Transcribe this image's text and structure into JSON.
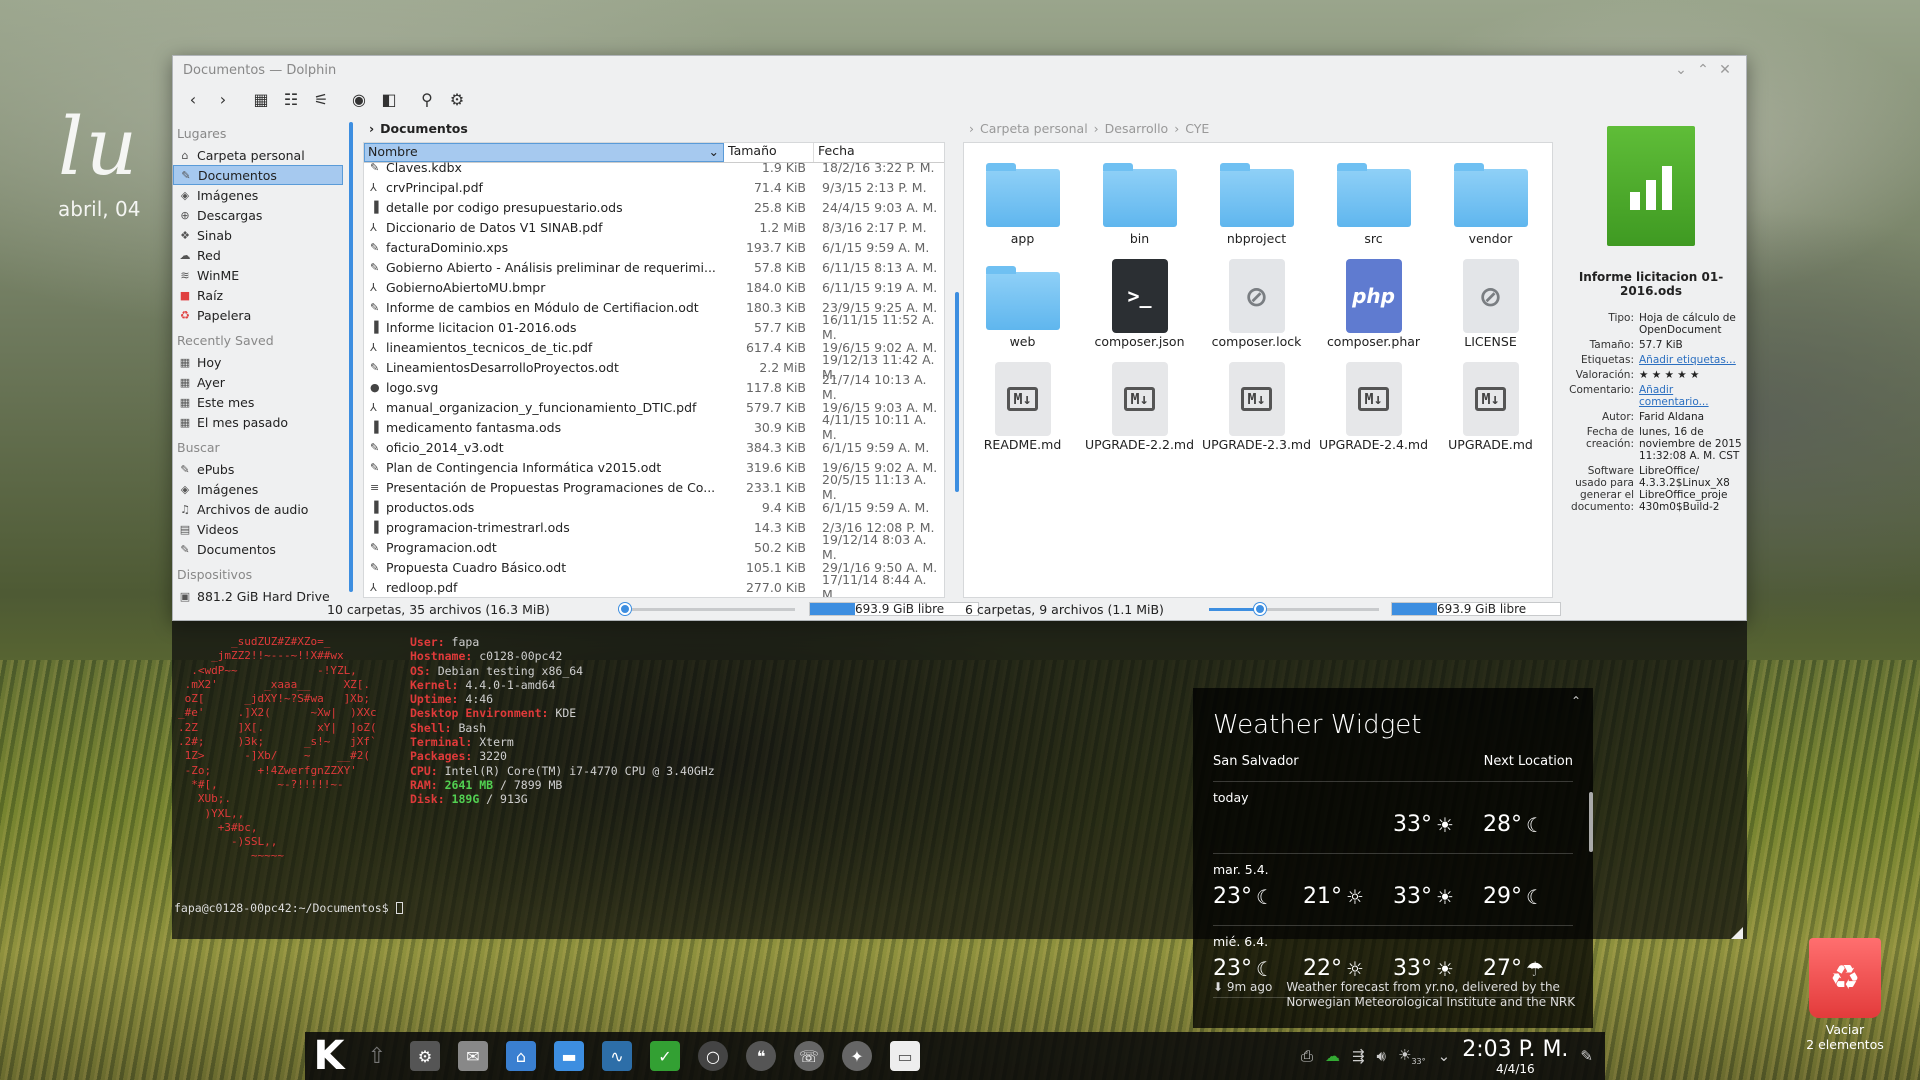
{
  "desktop": {
    "clock_day": "lu",
    "clock_date": "abril, 04"
  },
  "dolphin": {
    "title": "Documentos — Dolphin",
    "places": {
      "header_places": "Lugares",
      "items": [
        {
          "label": "Carpeta personal",
          "icon": "home-icon",
          "glyph": "⌂"
        },
        {
          "label": "Documentos",
          "icon": "documents-icon",
          "glyph": "✎",
          "selected": true
        },
        {
          "label": "Imágenes",
          "icon": "images-icon",
          "glyph": "◈"
        },
        {
          "label": "Descargas",
          "icon": "downloads-icon",
          "glyph": "⊕"
        },
        {
          "label": "Sinab",
          "icon": "folder-icon",
          "glyph": "❖"
        },
        {
          "label": "Red",
          "icon": "network-icon",
          "glyph": "☁"
        },
        {
          "label": "WinME",
          "icon": "wifi-icon",
          "glyph": "≋"
        },
        {
          "label": "Raíz",
          "icon": "root-folder-icon",
          "glyph": "■",
          "color": "#e04040"
        },
        {
          "label": "Papelera",
          "icon": "trash-icon",
          "glyph": "♻",
          "color": "#e04040"
        }
      ],
      "header_recent": "Recently Saved",
      "recent": [
        {
          "label": "Hoy",
          "icon": "calendar-icon",
          "glyph": "▦"
        },
        {
          "label": "Ayer",
          "icon": "calendar-icon",
          "glyph": "▦"
        },
        {
          "label": "Este mes",
          "icon": "calendar-icon",
          "glyph": "▦"
        },
        {
          "label": "El mes pasado",
          "icon": "calendar-icon",
          "glyph": "▦"
        }
      ],
      "header_search": "Buscar",
      "search": [
        {
          "label": "ePubs",
          "icon": "document-icon",
          "glyph": "✎"
        },
        {
          "label": "Imágenes",
          "icon": "image-icon",
          "glyph": "◈"
        },
        {
          "label": "Archivos de audio",
          "icon": "music-icon",
          "glyph": "♫"
        },
        {
          "label": "Videos",
          "icon": "video-icon",
          "glyph": "▤"
        },
        {
          "label": "Documentos",
          "icon": "document-icon",
          "glyph": "✎"
        }
      ],
      "header_devices": "Dispositivos",
      "devices": [
        {
          "label": "881.2 GiB Hard Drive",
          "icon": "harddrive-icon",
          "glyph": "▣"
        }
      ]
    },
    "left_pane": {
      "breadcrumb": "Documentos",
      "columns": {
        "name": "Nombre",
        "size": "Tamaño",
        "date": "Fecha"
      },
      "files": [
        {
          "name": "Claves.kdbx",
          "size": "1.9 KiB",
          "date": "18/2/16 3:22 P. M.",
          "glyph": "✎"
        },
        {
          "name": "crvPrincipal.pdf",
          "size": "71.4 KiB",
          "date": "9/3/15 2:13 P. M.",
          "glyph": "⅄"
        },
        {
          "name": "detalle por codigo presupuestario.ods",
          "size": "25.8 KiB",
          "date": "24/4/15 9:03 A. M.",
          "glyph": "▐"
        },
        {
          "name": "Diccionario de Datos V1 SINAB.pdf",
          "size": "1.2 MiB",
          "date": "8/3/16 2:17 P. M.",
          "glyph": "⅄"
        },
        {
          "name": "facturaDominio.xps",
          "size": "193.7 KiB",
          "date": "6/1/15 9:59 A. M.",
          "glyph": "✎"
        },
        {
          "name": "Gobierno Abierto - Análisis preliminar de requerimi...",
          "size": "57.8 KiB",
          "date": "6/11/15 8:13 A. M.",
          "glyph": "✎"
        },
        {
          "name": "GobiernoAbiertoMU.bmpr",
          "size": "184.0 KiB",
          "date": "6/11/15 9:19 A. M.",
          "glyph": "⅄"
        },
        {
          "name": "Informe de cambios en Módulo de Certifiacion.odt",
          "size": "180.3 KiB",
          "date": "23/9/15 9:25 A. M.",
          "glyph": "✎"
        },
        {
          "name": "Informe licitacion 01-2016.ods",
          "size": "57.7 KiB",
          "date": "16/11/15 11:52 A. M.",
          "glyph": "▐"
        },
        {
          "name": "lineamientos_tecnicos_de_tic.pdf",
          "size": "617.4 KiB",
          "date": "19/6/15 9:02 A. M.",
          "glyph": "⅄"
        },
        {
          "name": "LineamientosDesarrolloProyectos.odt",
          "size": "2.2 MiB",
          "date": "19/12/13 11:42 A. M.",
          "glyph": "✎"
        },
        {
          "name": "logo.svg",
          "size": "117.8 KiB",
          "date": "21/7/14 10:13 A. M.",
          "glyph": "●"
        },
        {
          "name": "manual_organizacion_y_funcionamiento_DTIC.pdf",
          "size": "579.7 KiB",
          "date": "19/6/15 9:03 A. M.",
          "glyph": "⅄"
        },
        {
          "name": "medicamento fantasma.ods",
          "size": "30.9 KiB",
          "date": "4/11/15 10:11 A. M.",
          "glyph": "▐"
        },
        {
          "name": "oficio_2014_v3.odt",
          "size": "384.3 KiB",
          "date": "6/1/15 9:59 A. M.",
          "glyph": "✎"
        },
        {
          "name": "Plan de Contingencia Informática v2015.odt",
          "size": "319.6 KiB",
          "date": "19/6/15 9:02 A. M.",
          "glyph": "✎"
        },
        {
          "name": "Presentación de Propuestas Programaciones de Co...",
          "size": "233.1 KiB",
          "date": "20/5/15 11:13 A. M.",
          "glyph": "≡"
        },
        {
          "name": "productos.ods",
          "size": "9.4 KiB",
          "date": "6/1/15 9:59 A. M.",
          "glyph": "▐"
        },
        {
          "name": "programacion-trimestrarl.ods",
          "size": "14.3 KiB",
          "date": "2/3/16 12:08 P. M.",
          "glyph": "▐"
        },
        {
          "name": "Programacion.odt",
          "size": "50.2 KiB",
          "date": "19/12/14 8:03 A. M.",
          "glyph": "✎"
        },
        {
          "name": "Propuesta Cuadro Básico.odt",
          "size": "105.1 KiB",
          "date": "29/1/16 9:50 A. M.",
          "glyph": "✎"
        },
        {
          "name": "redloop.pdf",
          "size": "277.0 KiB",
          "date": "17/11/14 8:44 A. M.",
          "glyph": "⅄"
        }
      ],
      "status": "10 carpetas, 35 archivos (16.3 MiB)",
      "zoom_fraction": 0.0,
      "free_space": "693.9 GiB libre",
      "used_fraction": 0.27
    },
    "right_pane": {
      "breadcrumb": [
        "Carpeta personal",
        "Desarrollo",
        "CYE"
      ],
      "items": [
        {
          "label": "app",
          "kind": "folder"
        },
        {
          "label": "bin",
          "kind": "folder"
        },
        {
          "label": "nbproject",
          "kind": "folder"
        },
        {
          "label": "src",
          "kind": "folder"
        },
        {
          "label": "vendor",
          "kind": "folder"
        },
        {
          "label": "web",
          "kind": "folder"
        },
        {
          "label": "composer.json",
          "kind": "term",
          "glyph": ">_"
        },
        {
          "label": "composer.lock",
          "kind": "lock",
          "glyph": "⊘"
        },
        {
          "label": "composer.phar",
          "kind": "php",
          "glyph": "php"
        },
        {
          "label": "LICENSE",
          "kind": "lock",
          "glyph": "⊘"
        },
        {
          "label": "README.md",
          "kind": "md",
          "glyph": "M↓"
        },
        {
          "label": "UPGRADE-2.2.md",
          "kind": "md",
          "glyph": "M↓"
        },
        {
          "label": "UPGRADE-2.3.md",
          "kind": "md",
          "glyph": "M↓"
        },
        {
          "label": "UPGRADE-2.4.md",
          "kind": "md",
          "glyph": "M↓"
        },
        {
          "label": "UPGRADE.md",
          "kind": "md",
          "glyph": "M↓"
        }
      ],
      "status": "6 carpetas, 9 archivos (1.1 MiB)",
      "zoom_fraction": 0.3,
      "free_space": "693.9 GiB libre",
      "used_fraction": 0.27
    },
    "info_panel": {
      "filename": "Informe licitacion 01-2016.ods",
      "fields": [
        {
          "k": "Tipo:",
          "v": "Hoja de cálculo de OpenDocument"
        },
        {
          "k": "Tamaño:",
          "v": "57.7 KiB"
        },
        {
          "k": "Etiquetas:",
          "v": "Añadir etiquetas...",
          "link": true
        },
        {
          "k": "Valoración:",
          "v": "★ ★ ★ ★ ★"
        },
        {
          "k": "Comentario:",
          "v": "Añadir comentario...",
          "link": true
        },
        {
          "k": "Autor:",
          "v": "Farid Aldana"
        },
        {
          "k": "Fecha de creación:",
          "v": "lunes, 16 de noviembre de 2015 11:32:08 A. M. CST"
        },
        {
          "k": "Software usado para generar el documento:",
          "v": "LibreOffice/ 4.3.3.2$Linux_X8 LibreOffice_proje 430m0$Build-2"
        }
      ]
    }
  },
  "terminal": {
    "logo": "        _sudZUZ#Z#XZo=_\n     _jmZZ2!!~---~!!X##wx\n  .<wdP~~            -!YZL,\n .mX2'       _xaaa__     XZ[.\n oZ[      _jdXY!~?S#wa   ]Xb;\n_#e'     .]X2(      ~Xw|  )XXc\n.2Z      ]X[.        xY|  ]oZ(\n.2#;     )3k;      _s!~   jXf`\n 1Z>      -]Xb/    ~    __#2(\n -Zo;       +!4ZwerfgnZZXY'\n  *#[,         ~-?!!!!!~-\n   XUb;.\n    )YXL,,\n      +3#bc,\n        -)SSL,,\n           ~~~~~",
    "info": [
      {
        "k": "User:",
        "v": " fapa"
      },
      {
        "k": "Hostname:",
        "v": " c0128-00pc42"
      },
      {
        "k": "OS:",
        "v": " Debian testing x86_64"
      },
      {
        "k": "Kernel:",
        "v": " 4.4.0-1-amd64"
      },
      {
        "k": "Uptime:",
        "v": " 4:46"
      },
      {
        "k": "Desktop Environment:",
        "v": " KDE"
      },
      {
        "k": "Shell:",
        "v": " Bash"
      },
      {
        "k": "Terminal:",
        "v": " Xterm"
      },
      {
        "k": "Packages:",
        "v": " 3220"
      },
      {
        "k": "CPU:",
        "v": " Intel(R) Core(TM) i7-4770 CPU @ 3.40GHz"
      },
      {
        "k": "RAM:",
        "v": " / 7899 MB",
        "hi": " 2641 MB"
      },
      {
        "k": "Disk:",
        "v": " / 913G",
        "hi": " 189G"
      }
    ],
    "prompt": "fapa@c0128-00pc42:~/Documentos$ "
  },
  "weather": {
    "title": "Weather Widget",
    "location": "San Salvador",
    "next_location": "Next Location",
    "days": [
      {
        "label": "today",
        "temps": [
          {
            "t": "",
            "icon": ""
          },
          {
            "t": "",
            "icon": ""
          },
          {
            "t": "33°",
            "icon": "☀"
          },
          {
            "t": "28°",
            "icon": "☾"
          }
        ]
      },
      {
        "label": "mar. 5.4.",
        "temps": [
          {
            "t": "23°",
            "icon": "☾"
          },
          {
            "t": "21°",
            "icon": "☼"
          },
          {
            "t": "33°",
            "icon": "☀"
          },
          {
            "t": "29°",
            "icon": "☾"
          }
        ]
      },
      {
        "label": "mié. 6.4.",
        "temps": [
          {
            "t": "23°",
            "icon": "☾"
          },
          {
            "t": "22°",
            "icon": "☼"
          },
          {
            "t": "33°",
            "icon": "☀"
          },
          {
            "t": "27°",
            "icon": "☂"
          }
        ]
      }
    ],
    "ago": "⬇ 9m ago",
    "credit": "Weather forecast from yr.no, delivered by the Norwegian Meteorological Institute and the NRK"
  },
  "trash": {
    "line1": "Vaciar",
    "line2": "2 elementos"
  },
  "panel": {
    "launcher": "K",
    "time": "2:03 P. M.",
    "date": "4/4/16",
    "weather_temp": "33°"
  }
}
